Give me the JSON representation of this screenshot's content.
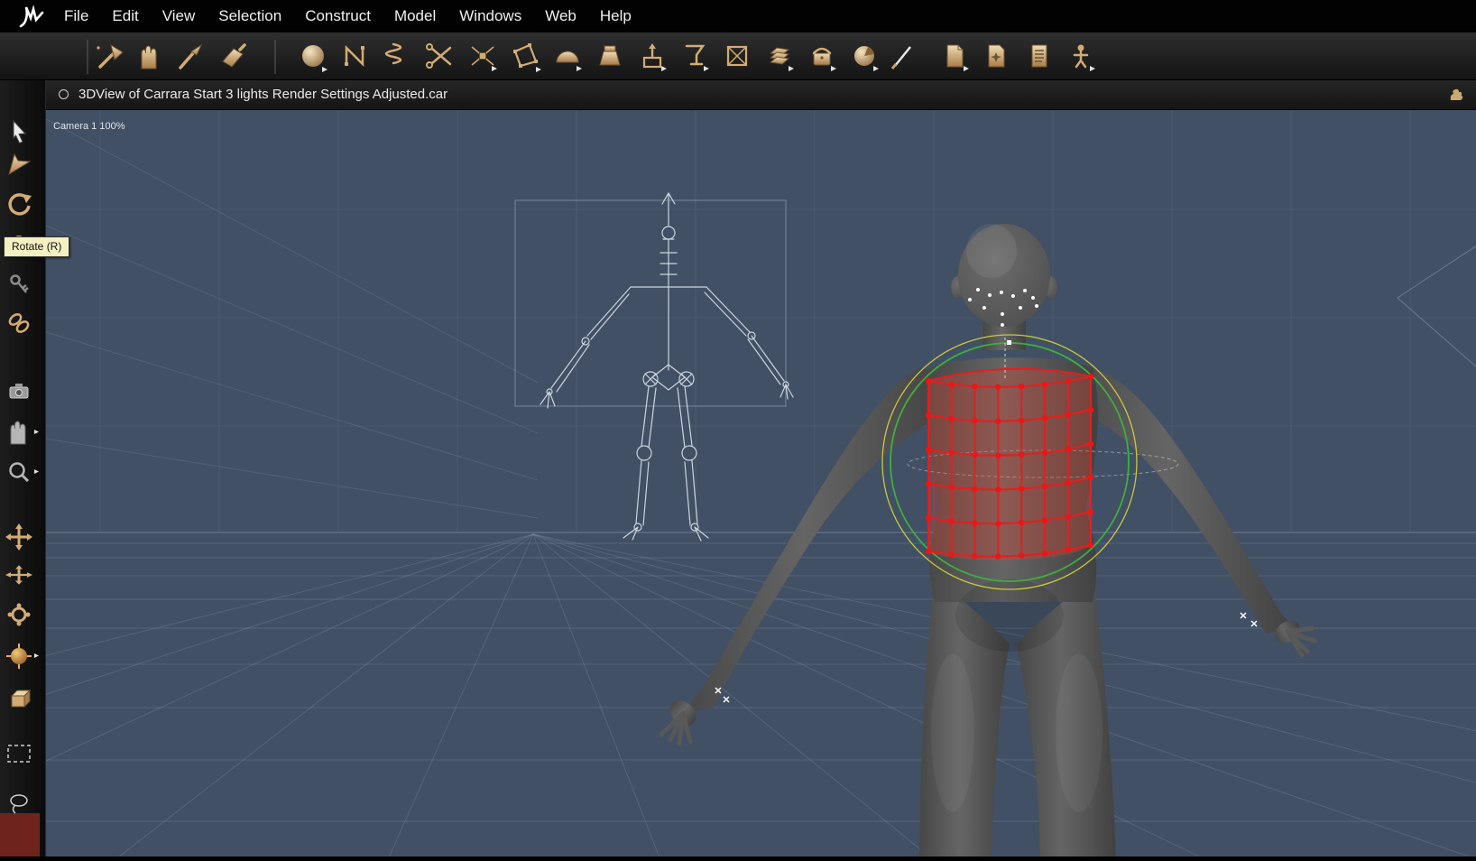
{
  "menu_bar": {
    "items": [
      "File",
      "Edit",
      "View",
      "Selection",
      "Construct",
      "Model",
      "Windows",
      "Web",
      "Help"
    ]
  },
  "toolbar": {
    "groups": [
      {
        "name": "general",
        "tools": [
          "axe-tool",
          "hand-tool",
          "brush-tool",
          "trowel-tool"
        ]
      },
      {
        "name": "modeling",
        "tools": [
          "sphere-tool",
          "spline-tool",
          "spring-tool",
          "scissors-tool",
          "vertex-tool",
          "polygon-tool",
          "dome-tool",
          "bolt-tool",
          "extrude-tool",
          "goblet-tool",
          "boxed-x-tool",
          "stack-tool",
          "bag-tool",
          "pie-sphere-tool",
          "pencil-tool"
        ]
      },
      {
        "name": "pages",
        "tools": [
          "page-curl-tool",
          "page-star-tool",
          "text-lines-tool",
          "figure-tool"
        ]
      }
    ]
  },
  "left_toolbar": {
    "tools": [
      "select-arrow-tool",
      "nav-arrow-tool",
      "rotate-tool",
      "rotate-sphere-tool",
      "key-tool",
      "link-tool",
      "camera-tool",
      "pan-hand-tool",
      "zoom-tool",
      "move-xy-tool",
      "move-xz-tool",
      "rotate-gear-tool",
      "target-sphere-tool",
      "box-tool",
      "marquee-select-tool",
      "lasso-select-tool"
    ],
    "tooltip": "Rotate (R)"
  },
  "viewport": {
    "title": "3DView of Carrara Start 3 lights Render Settings Adjusted.car",
    "camera_label": "Camera 1 100%"
  },
  "scene": {
    "objects": [
      "skeleton-armature",
      "humanoid-figure",
      "selection-mesh-cylinder",
      "rotation-manipulator"
    ],
    "selection_grid": {
      "rows": 6,
      "cols": 8
    },
    "colors": {
      "viewport_bg": "#415064",
      "grid": "#8fa3c0",
      "selection_red": "#e61e1e",
      "manipulator_green": "#3fae3f",
      "manipulator_yellow": "#c9c93e"
    }
  }
}
